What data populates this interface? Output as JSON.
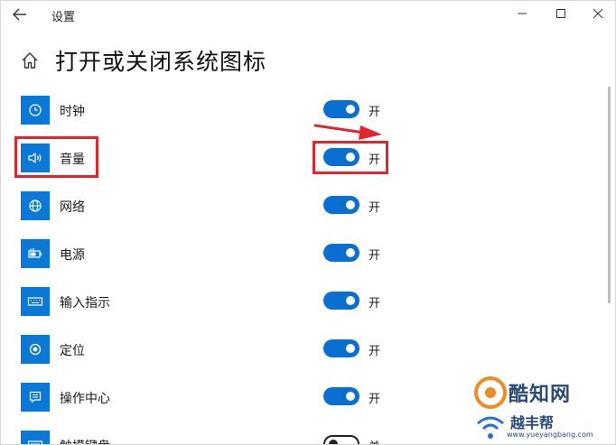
{
  "window": {
    "title": "设置"
  },
  "page": {
    "title": "打开或关闭系统图标"
  },
  "rows": [
    {
      "label": "时钟",
      "icon": "clock-icon",
      "state": "开",
      "on": true
    },
    {
      "label": "音量",
      "icon": "volume-icon",
      "state": "开",
      "on": true
    },
    {
      "label": "网络",
      "icon": "globe-icon",
      "state": "开",
      "on": true
    },
    {
      "label": "电源",
      "icon": "battery-icon",
      "state": "开",
      "on": true
    },
    {
      "label": "输入指示",
      "icon": "keyboard-icon",
      "state": "开",
      "on": true
    },
    {
      "label": "定位",
      "icon": "location-icon",
      "state": "开",
      "on": true
    },
    {
      "label": "操作中心",
      "icon": "action-center-icon",
      "state": "开",
      "on": true
    },
    {
      "label": "触摸键盘",
      "icon": "touch-keyboard-icon",
      "state": "关",
      "on": false
    }
  ],
  "watermark": {
    "line1": "酷知网",
    "line2": "越丰帮",
    "line3": "www.yueyangbang.com"
  },
  "colors": {
    "accent": "#0a78d7",
    "annotation": "#e1252f"
  }
}
